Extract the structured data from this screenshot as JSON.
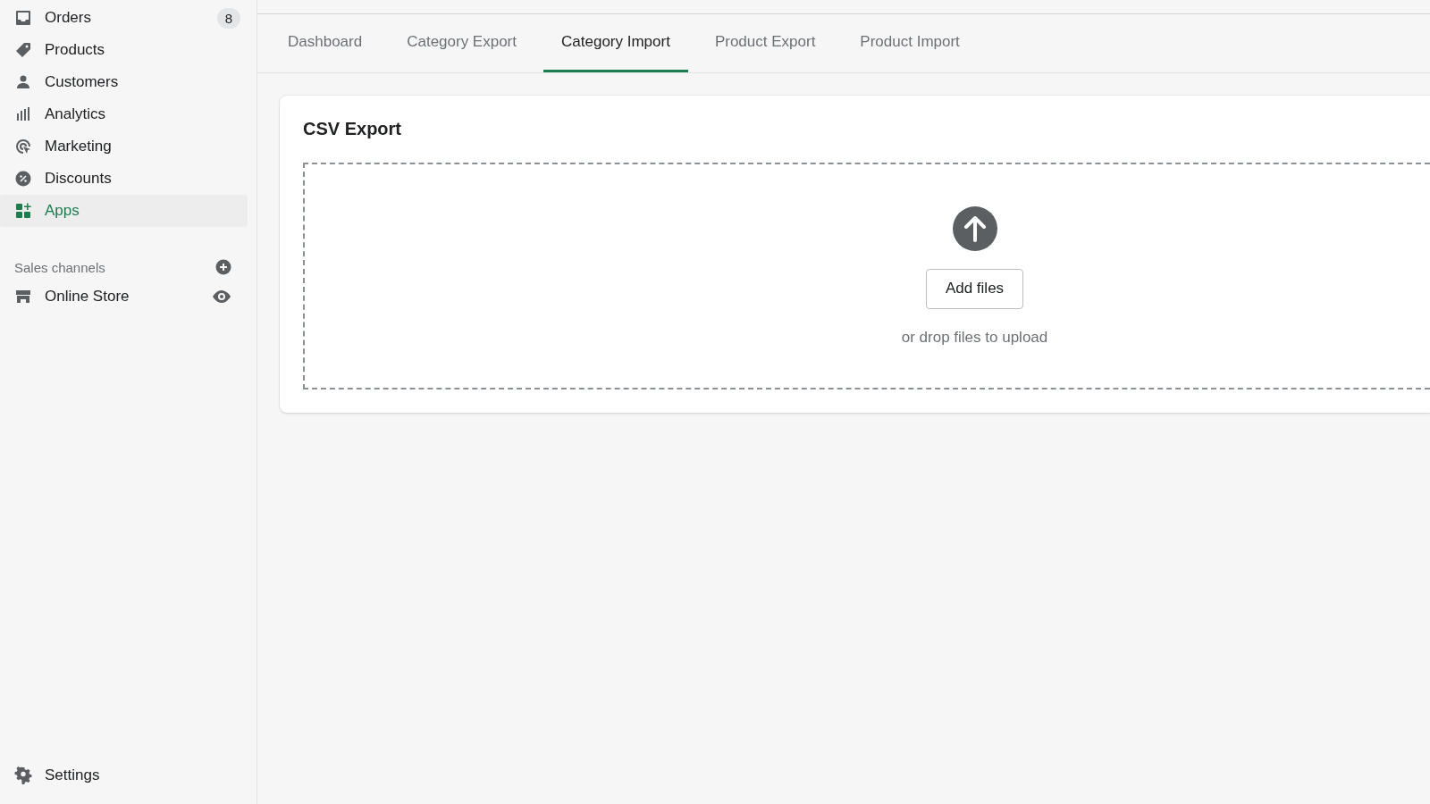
{
  "sidebar": {
    "items": [
      {
        "label": "Orders",
        "badge": "8",
        "selected": false
      },
      {
        "label": "Products",
        "selected": false
      },
      {
        "label": "Customers",
        "selected": false
      },
      {
        "label": "Analytics",
        "selected": false
      },
      {
        "label": "Marketing",
        "selected": false
      },
      {
        "label": "Discounts",
        "selected": false
      },
      {
        "label": "Apps",
        "selected": true
      }
    ],
    "sales_channels": {
      "heading": "Sales channels",
      "items": [
        {
          "label": "Online Store"
        }
      ]
    },
    "settings": {
      "label": "Settings"
    }
  },
  "tabs": [
    {
      "label": "Dashboard",
      "selected": false
    },
    {
      "label": "Category Export",
      "selected": false
    },
    {
      "label": "Category Import",
      "selected": true
    },
    {
      "label": "Product Export",
      "selected": false
    },
    {
      "label": "Product Import",
      "selected": false
    }
  ],
  "card": {
    "title": "CSV Export",
    "dropzone": {
      "button": "Add files",
      "hint": "or drop files to upload"
    }
  }
}
